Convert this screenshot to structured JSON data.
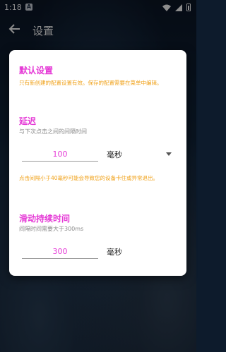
{
  "status": {
    "time": "1:18",
    "app_badge": "A"
  },
  "appbar": {
    "title": "设置"
  },
  "dialog": {
    "default": {
      "title": "默认设置",
      "note": "只有新创建的配置设置有效。保存的配置需要在菜单中编辑。"
    },
    "delay": {
      "title": "延迟",
      "subtitle": "与下次点击之间的间隔时间",
      "value": "100",
      "unit": "毫秒",
      "warning": "点击间隔小于40毫秒可能会导致您的设备卡住或异常退出。"
    },
    "swipe": {
      "title": "滑动持续时间",
      "subtitle": "间隔时间需要大于300ms",
      "value": "300",
      "unit": "毫秒"
    }
  }
}
